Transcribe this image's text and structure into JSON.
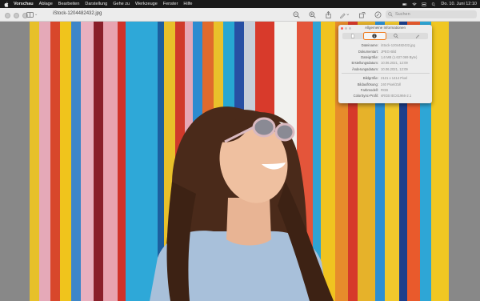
{
  "menubar": {
    "app": "Vorschau",
    "items": [
      "Ablage",
      "Bearbeiten",
      "Darstellung",
      "Gehe zu",
      "Werkzeuge",
      "Fenster",
      "Hilfe"
    ],
    "clock": "Do. 10. Juni 12:10"
  },
  "window": {
    "title": "iStock-1204482432.jpg",
    "search_placeholder": "Suchen"
  },
  "inspector": {
    "title": "Allgemeine Informationen",
    "tabs": [
      "general-tab",
      "info-tab",
      "magnify-tab",
      "annotations-tab"
    ],
    "active_tab": 1,
    "accent": "#f07a1a",
    "section1": [
      {
        "label": "Dateiname:",
        "value": "iStock-1204482432.jpg"
      },
      {
        "label": "Dokumentart:",
        "value": "JPEG-Bild"
      },
      {
        "label": "Dateigröße:",
        "value": "1,6 MB (1.637.069 Byte)"
      },
      {
        "label": "Erstellungsdatum:",
        "value": "10.06.2021, 12:09"
      },
      {
        "label": "Änderungsdatum:",
        "value": "10.06.2021, 12:09"
      }
    ],
    "section2": [
      {
        "label": "Bildgröße:",
        "value": "2121 x 1414 Pixel"
      },
      {
        "label": "Bildauflösung:",
        "value": "240 Pixel/Zoll"
      },
      {
        "label": "Farbmodell:",
        "value": "RGB"
      },
      {
        "label": "ColorSync-Profil:",
        "value": "sRGB IEC61966-2.1"
      }
    ]
  }
}
